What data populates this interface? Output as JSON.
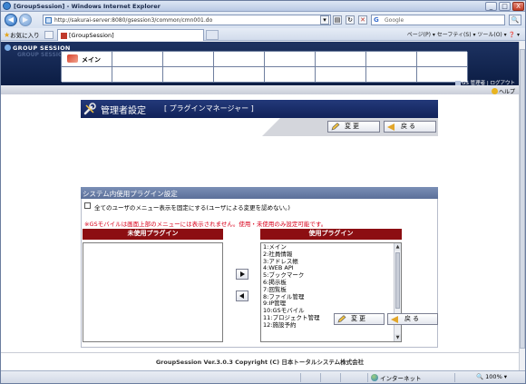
{
  "window": {
    "title": "[GroupSession] - Windows Internet Explorer",
    "min_label": "_",
    "max_label": "□",
    "close_label": "X"
  },
  "browser": {
    "back_label": "◀",
    "forward_label": "▶",
    "address": "http://sakurai-server:8080/gsession3/common/cmn001.do",
    "search_placeholder": "Google",
    "search_go_label": "🔍",
    "favorites_label": "お気に入り",
    "tab_title": "[GroupSession]",
    "command_bar": "ページ(P) ▾  セーフティ(S) ▾  ツール(O) ▾  ❓ ▾",
    "status_zone": "インターネット",
    "zoom": "🔍 100% ▾"
  },
  "gs": {
    "logo": "GROUP SESSION",
    "logo_ghost": "GROUP SESSION",
    "menu_main": "メイン",
    "admin_link": "GS 管理者 | ログアウト",
    "help_label": "ヘルプ"
  },
  "page": {
    "title": "管理者設定",
    "subtitle": "[ プラグインマネージャー ]",
    "change_button": "変更",
    "back_button": "戻る"
  },
  "settings": {
    "section_title": "システム内使用プラグイン設定",
    "checkbox_label": "全てのユーザのメニュー表示を固定にする(ユーザによる変更を認めない。)",
    "checkbox_checked": false,
    "note": "※GSモバイルは画面上部のメニューには表示されません。使用・未使用のみ設定可能です。",
    "unused_header": "未使用プラグイン",
    "used_header": "使用プラグイン",
    "unused_plugins": [],
    "used_plugins": [
      "1:メイン",
      "2:社員情報",
      "3:アドレス帳",
      "4:WEB API",
      "5:ブックマーク",
      "6:掲示板",
      "7:回覧板",
      "8:ファイル管理",
      "9:IP管理",
      "10:GSモバイル",
      "11:プロジェクト管理",
      "12:施設予約"
    ]
  },
  "footer": {
    "copyright": "GroupSession Ver.3.0.3 Copyright (C) 日本トータルシステム株式会社"
  },
  "colors": {
    "header_navy": "#0c1d44",
    "list_header_red": "#8c0e12",
    "note_red": "#d9001b",
    "section_blue": "#5b6f99"
  }
}
